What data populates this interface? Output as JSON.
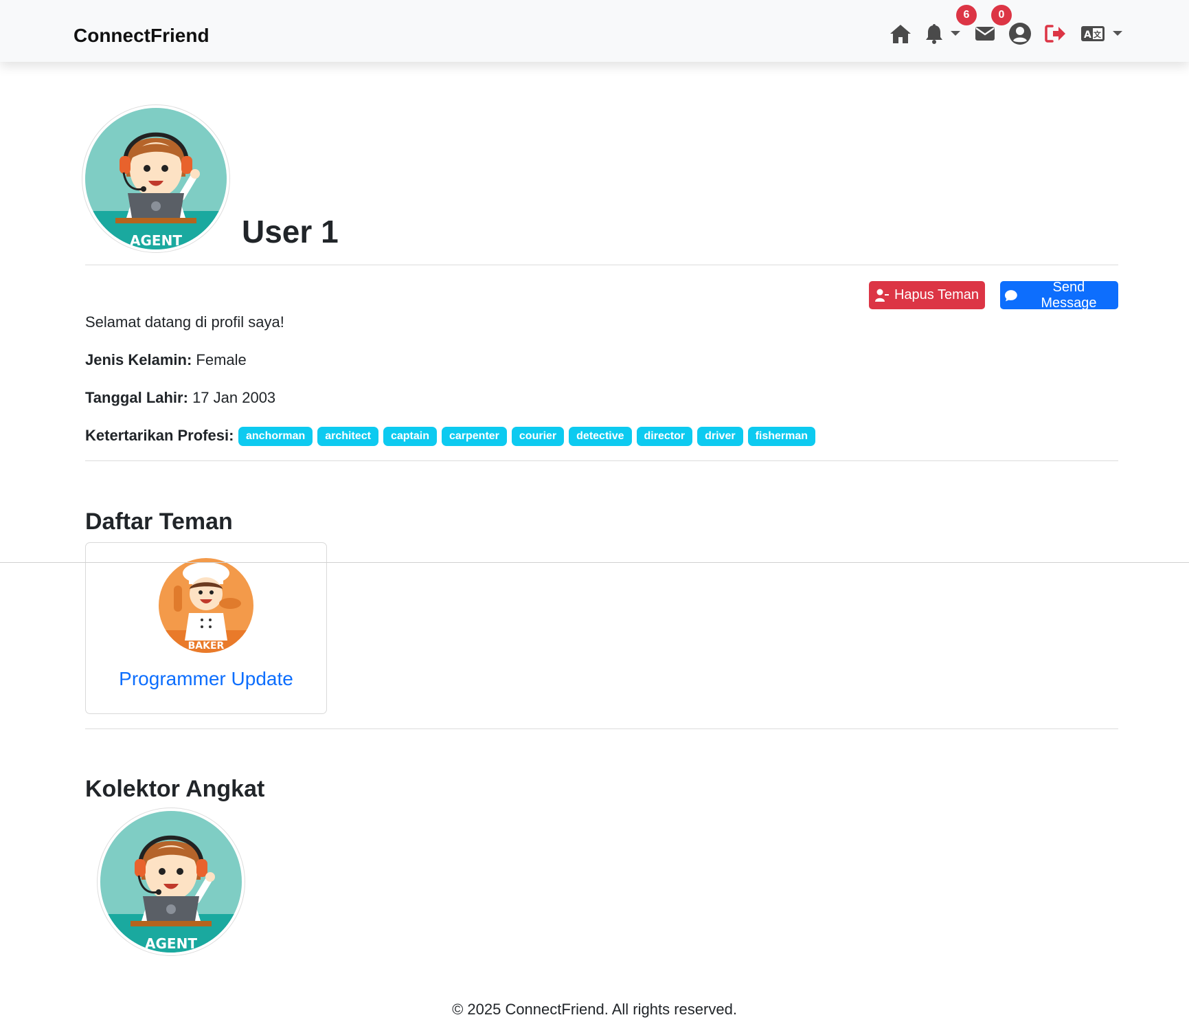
{
  "navbar": {
    "brand": "ConnectFriend",
    "icons": [
      "home-icon",
      "bell-icon",
      "envelope-icon",
      "user-circle-icon",
      "logout-icon",
      "language-icon"
    ],
    "notification_count": "6",
    "message_count": "0"
  },
  "profile": {
    "name": "User 1",
    "avatar_label": "AGENT",
    "bio": "Selamat datang di profil saya!",
    "gender_label": "Jenis Kelamin:",
    "gender_value": "Female",
    "birthdate_label": "Tanggal Lahir:",
    "birthdate_value": "17 Jan 2003",
    "interests_label": "Ketertarikan Profesi:",
    "interests": [
      "anchorman",
      "architect",
      "captain",
      "carpenter",
      "courier",
      "detective",
      "director",
      "driver",
      "fisherman"
    ]
  },
  "actions": {
    "remove_friend": "Hapus Teman",
    "send_message": "Send Message"
  },
  "friends": {
    "title": "Daftar Teman",
    "items": [
      {
        "name": "Programmer Update",
        "avatar_label": "BAKER"
      }
    ]
  },
  "collector": {
    "title": "Kolektor Angkat",
    "avatar_label": "AGENT"
  },
  "footer": {
    "text": "© 2025 ConnectFriend. All rights reserved."
  },
  "colors": {
    "danger": "#dc3545",
    "primary": "#0d6efd",
    "info": "#0dcaf0",
    "navbar_bg": "#f8f9fa"
  }
}
